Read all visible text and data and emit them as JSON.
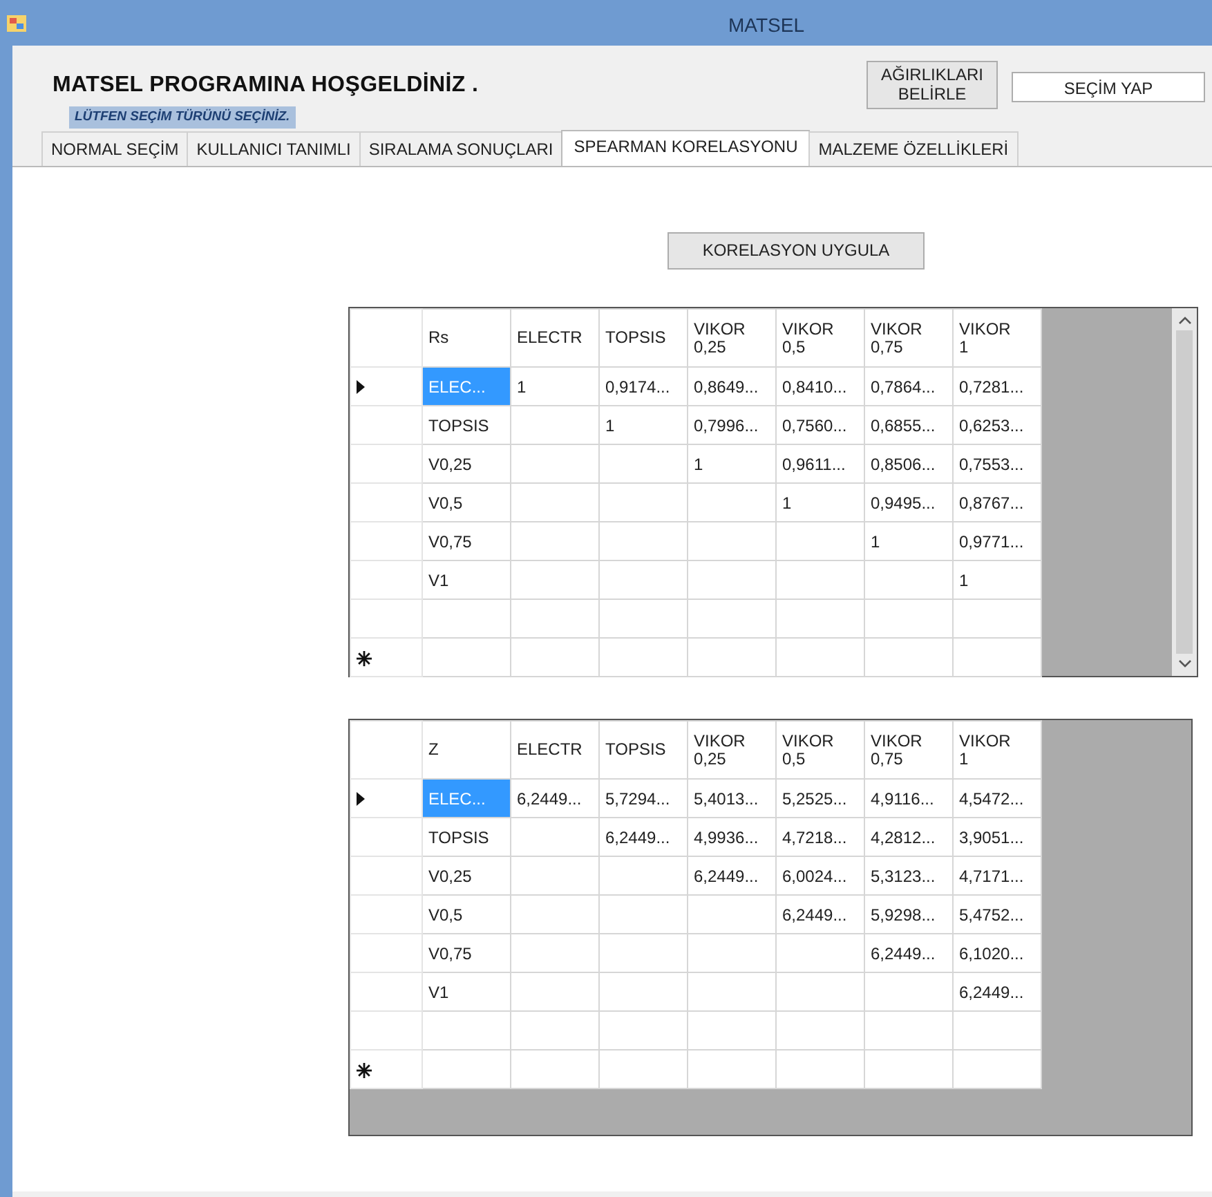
{
  "window": {
    "title": "MATSEL"
  },
  "header": {
    "title": "MATSEL PROGRAMINA HOŞGELDİNİZ .",
    "subtitle": "LÜTFEN SEÇİM TÜRÜNÜ SEÇİNİZ."
  },
  "buttons": [
    "AĞIRLIKLARI BELİRLE",
    "SEÇİM YAP"
  ],
  "tabs": [
    {
      "label": "NORMAL SEÇİM",
      "selected": false
    },
    {
      "label": "KULLANICI TANIMLI",
      "selected": false
    },
    {
      "label": "SIRALAMA SONUÇLARI",
      "selected": false
    },
    {
      "label": "SPEARMAN KORELASYONU",
      "selected": true
    },
    {
      "label": "MALZEME ÖZELLİKLERİ",
      "selected": false
    }
  ],
  "action_button": "KORELASYON UYGULA",
  "grids": [
    {
      "columns": [
        "Rs",
        "ELECTR",
        "TOPSIS",
        "VIKOR\n0,25",
        "VIKOR\n0,5",
        "VIKOR\n0,75",
        "VIKOR\n1"
      ],
      "scrollbar": true,
      "rows": [
        {
          "kind": "data",
          "selected": true,
          "cells": [
            "ELEC...",
            "1",
            "0,9174...",
            "0,8649...",
            "0,8410...",
            "0,7864...",
            "0,7281..."
          ]
        },
        {
          "kind": "data",
          "selected": false,
          "cells": [
            "TOPSIS",
            null,
            "1",
            "0,7996...",
            "0,7560...",
            "0,6855...",
            "0,6253..."
          ]
        },
        {
          "kind": "data",
          "selected": false,
          "cells": [
            "V0,25",
            null,
            null,
            "1",
            "0,9611...",
            "0,8506...",
            "0,7553..."
          ]
        },
        {
          "kind": "data",
          "selected": false,
          "cells": [
            "V0,5",
            null,
            null,
            null,
            "1",
            "0,9495...",
            "0,8767..."
          ]
        },
        {
          "kind": "data",
          "selected": false,
          "cells": [
            "V0,75",
            null,
            null,
            null,
            null,
            "1",
            "0,9771..."
          ]
        },
        {
          "kind": "data",
          "selected": false,
          "cells": [
            "V1",
            null,
            null,
            null,
            null,
            null,
            "1"
          ]
        },
        {
          "kind": "blank"
        },
        {
          "kind": "new"
        }
      ]
    },
    {
      "columns": [
        "Z",
        "ELECTR",
        "TOPSIS",
        "VIKOR\n0,25",
        "VIKOR\n0,5",
        "VIKOR\n0,75",
        "VIKOR\n1"
      ],
      "scrollbar": false,
      "rows": [
        {
          "kind": "data",
          "selected": true,
          "cells": [
            "ELEC...",
            "6,2449...",
            "5,7294...",
            "5,4013...",
            "5,2525...",
            "4,9116...",
            "4,5472..."
          ]
        },
        {
          "kind": "data",
          "selected": false,
          "cells": [
            "TOPSIS",
            null,
            "6,2449...",
            "4,9936...",
            "4,7218...",
            "4,2812...",
            "3,9051..."
          ]
        },
        {
          "kind": "data",
          "selected": false,
          "cells": [
            "V0,25",
            null,
            null,
            "6,2449...",
            "6,0024...",
            "5,3123...",
            "4,7171..."
          ]
        },
        {
          "kind": "data",
          "selected": false,
          "cells": [
            "V0,5",
            null,
            null,
            null,
            "6,2449...",
            "5,9298...",
            "5,4752..."
          ]
        },
        {
          "kind": "data",
          "selected": false,
          "cells": [
            "V0,75",
            null,
            null,
            null,
            null,
            "6,2449...",
            "6,1020..."
          ]
        },
        {
          "kind": "data",
          "selected": false,
          "cells": [
            "V1",
            null,
            null,
            null,
            null,
            null,
            "6,2449..."
          ]
        },
        {
          "kind": "blank"
        },
        {
          "kind": "new"
        }
      ]
    }
  ]
}
